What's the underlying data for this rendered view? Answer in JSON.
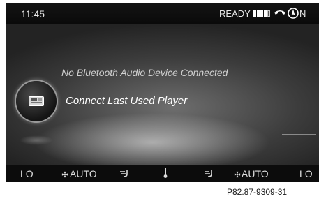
{
  "status": {
    "time": "11:45",
    "ready": "READY",
    "heading": "N",
    "icons": [
      "signal-bars-icon",
      "phone-icon",
      "compass-icon"
    ]
  },
  "main": {
    "message": "No Bluetooth Audio Device Connected",
    "action_label": "Connect Last Used Player",
    "action_icon": "bluetooth-device-icon"
  },
  "climate": {
    "left_temp": "LO",
    "left_fan": "AUTO",
    "right_fan": "AUTO",
    "right_temp": "LO",
    "icons": [
      "fan-icon",
      "airflow-icon",
      "thermometer-icon",
      "airflow-icon",
      "fan-icon"
    ]
  },
  "figure_ref": "P82.87-9309-31",
  "colors": {
    "screen_bg": "#3c3c3c",
    "statusbar_bg": "#0a0a0a",
    "text": "#e8e8e8"
  }
}
